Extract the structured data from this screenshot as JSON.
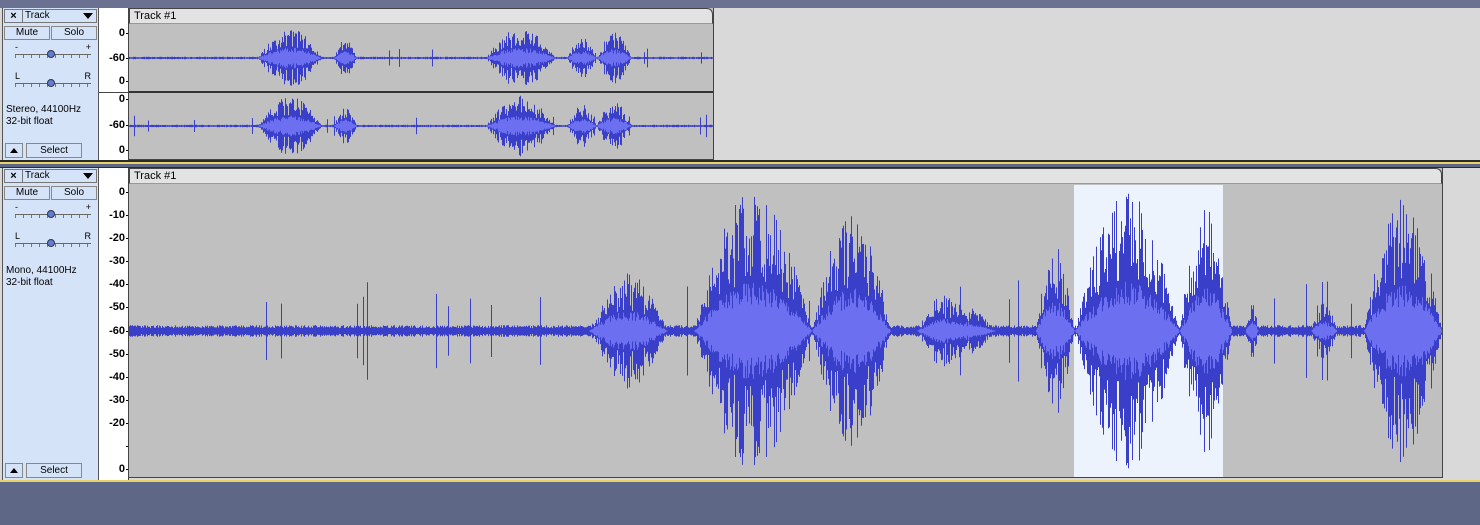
{
  "colors": {
    "waveform": "#3a3fc9",
    "waveform_rms": "#6b6ff0",
    "clip_bg": "#c0c0c0",
    "selection": "#edf3fd",
    "panel_bg": "#d5e3f8"
  },
  "tracks": [
    {
      "name": "Track",
      "close_icon": "×",
      "mute_label": "Mute",
      "solo_label": "Solo",
      "gain_minus": "-",
      "gain_plus": "+",
      "pan_left": "L",
      "pan_right": "R",
      "gain_level": 0.5,
      "pan_level": 0.5,
      "format": "Stereo, 44100Hz",
      "sample_format": "32-bit float",
      "select_label": "Select",
      "clip_title": "Track #1",
      "channels": [
        {
          "ruler": [
            "0",
            "-60",
            "0"
          ]
        },
        {
          "ruler": [
            "0",
            "-60",
            "0"
          ]
        }
      ]
    },
    {
      "name": "Track",
      "close_icon": "×",
      "mute_label": "Mute",
      "solo_label": "Solo",
      "gain_minus": "-",
      "gain_plus": "+",
      "pan_left": "L",
      "pan_right": "R",
      "gain_level": 0.5,
      "pan_level": 0.5,
      "format": "Mono, 44100Hz",
      "sample_format": "32-bit float",
      "select_label": "Select",
      "clip_title": "Track #1",
      "channels": [
        {
          "ruler": [
            "0",
            "-10",
            "-20",
            "-30",
            "-40",
            "-50",
            "-60",
            "-50",
            "-40",
            "-30",
            "-20",
            "",
            "0"
          ]
        }
      ]
    }
  ]
}
